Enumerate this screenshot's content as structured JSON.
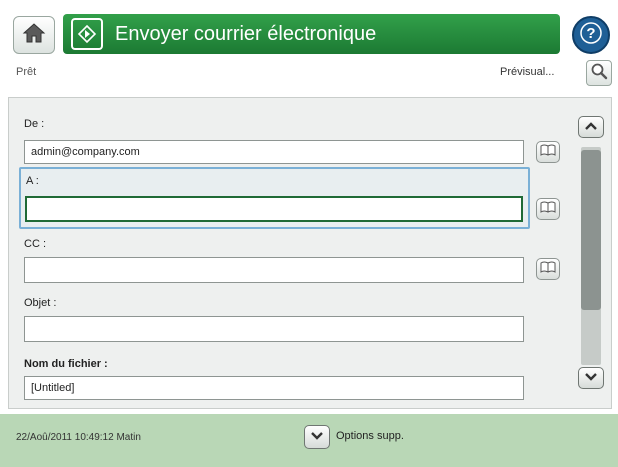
{
  "header": {
    "title": "Envoyer courrier électronique",
    "home_icon": "home-icon",
    "title_icon": "send-email-icon",
    "help_icon": "help-icon",
    "accent_color": "#2a8c41"
  },
  "status": {
    "text": "Prêt",
    "preview_label": "Prévisual..."
  },
  "form": {
    "from": {
      "label": "De :",
      "value": "admin@company.com"
    },
    "to": {
      "label": "A :",
      "value": ""
    },
    "cc": {
      "label": "CC :",
      "value": ""
    },
    "subject": {
      "label": "Objet :",
      "value": ""
    },
    "filename": {
      "label": "Nom du fichier :",
      "value": "[Untitled]"
    }
  },
  "footer": {
    "datetime": "22/Aoû/2011 10:49:12 Matin",
    "more_options_label": "Options supp."
  }
}
